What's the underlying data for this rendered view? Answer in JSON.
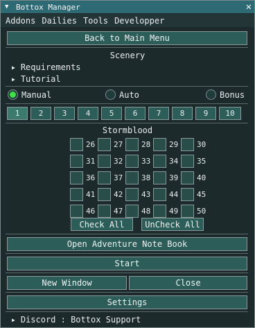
{
  "window": {
    "title": "Bottox Manager",
    "close_glyph": "✕",
    "collapse_glyph": "▼"
  },
  "menu": [
    "Addons",
    "Dailies",
    "Tools",
    "Developper"
  ],
  "back_button": "Back to Main Menu",
  "scenery": {
    "header": "Scenery",
    "tree": [
      "Requirements",
      "Tutorial"
    ],
    "modes": [
      {
        "label": "Manual",
        "selected": true
      },
      {
        "label": "Auto",
        "selected": false
      },
      {
        "label": "Bonus",
        "selected": false
      }
    ],
    "pages": [
      "1",
      "2",
      "3",
      "4",
      "5",
      "6",
      "7",
      "8",
      "9",
      "10"
    ],
    "selected_page": "1"
  },
  "stormblood": {
    "header": "Stormblood",
    "levels": [
      [
        "26",
        "27",
        "28",
        "29",
        "30"
      ],
      [
        "31",
        "32",
        "33",
        "34",
        "35"
      ],
      [
        "36",
        "37",
        "38",
        "39",
        "40"
      ],
      [
        "41",
        "42",
        "43",
        "44",
        "45"
      ],
      [
        "46",
        "47",
        "48",
        "49",
        "50"
      ]
    ],
    "check_all": "Check All",
    "uncheck_all": "UnCheck All"
  },
  "buttons": {
    "note_book": "Open Adventure Note Book",
    "start": "Start",
    "new_window": "New Window",
    "close": "Close",
    "settings": "Settings"
  },
  "footer": {
    "discord": "Discord : Bottox Support"
  }
}
